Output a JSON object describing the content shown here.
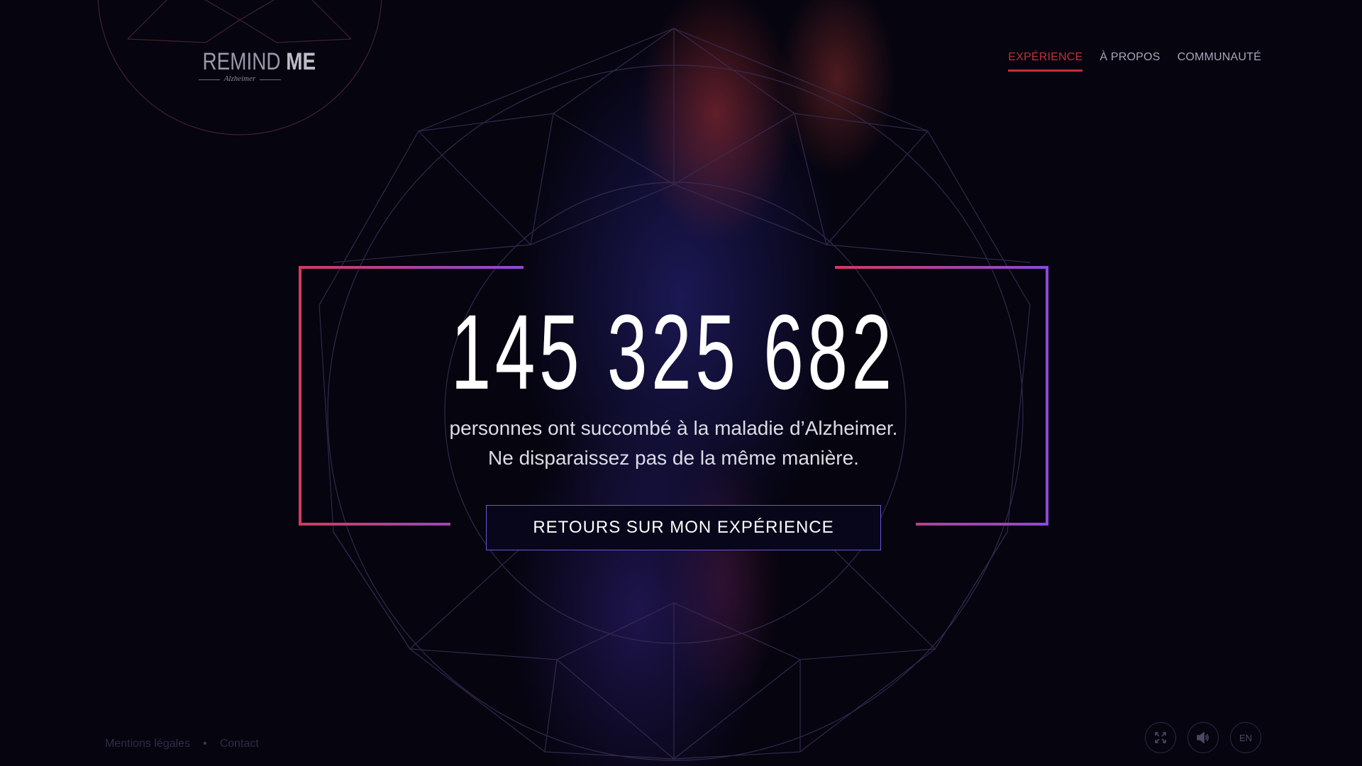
{
  "logo": {
    "main_light": "REMIND ",
    "main_bold": "ME",
    "sub": "Alzheimer"
  },
  "nav": {
    "items": [
      {
        "label": "EXPÉRIENCE",
        "active": true
      },
      {
        "label": "À PROPOS",
        "active": false
      },
      {
        "label": "COMMUNAUTÉ",
        "active": false
      }
    ]
  },
  "hero": {
    "number": "145 325 682",
    "line1": "personnes ont succombé à la maladie d’Alzheimer.",
    "line2": "Ne disparaissez pas de la même manière."
  },
  "cta": {
    "label": "RETOURS SUR MON EXPÉRIENCE"
  },
  "footer": {
    "legal": "Mentions légales",
    "separator": "•",
    "contact": "Contact"
  },
  "controls": {
    "fullscreen_icon": "fullscreen-icon",
    "sound_icon": "speaker-icon",
    "lang": "EN"
  },
  "colors": {
    "accent_red": "#c0303b",
    "frame_start": "#d23a62",
    "frame_end": "#8a4ad8",
    "button_border": "#6c55d8"
  }
}
